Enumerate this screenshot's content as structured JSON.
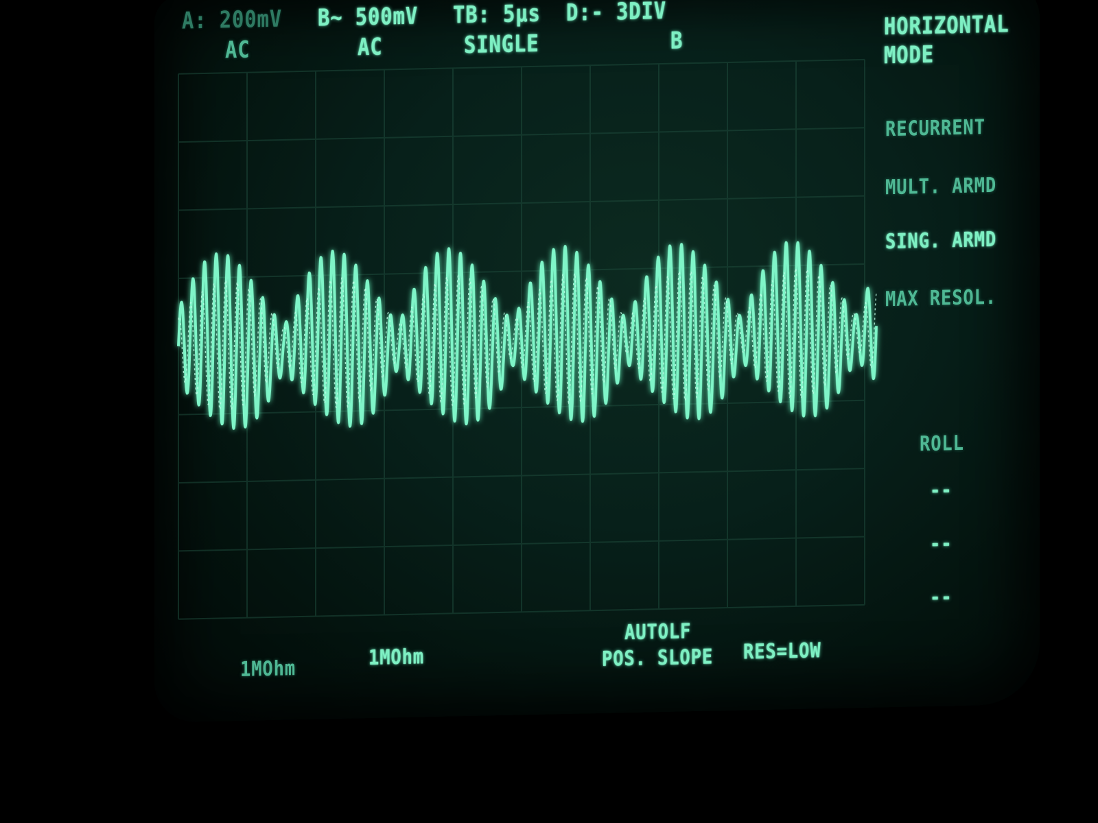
{
  "header": {
    "ch_a": "A: 200mV",
    "ch_b": "B~ 500mV",
    "timebase": "TB:   5μs",
    "delay": "D:-   3DIV",
    "ch_a_coupling": "AC",
    "ch_b_coupling": "AC",
    "trigger_mode": "SINGLE",
    "trigger_source": "B"
  },
  "softkeys": {
    "menu_title_1": "HORIZONTAL",
    "menu_title_2": "MODE",
    "recurrent": "RECURRENT",
    "mult_armd": "MULT. ARMD",
    "sing_armd": "SING. ARMD",
    "max_resol": "MAX RESOL.",
    "roll": "ROLL",
    "blank_1": "--",
    "blank_2": "--",
    "blank_3": "--"
  },
  "footer": {
    "ch_a_impedance": "1MOhm",
    "ch_b_impedance": "1MOhm",
    "trigger_coupling": "AUTOLF",
    "slope": "POS. SLOPE",
    "resolution": "RES=LOW"
  },
  "colors": {
    "phosphor": "#7ef0c3",
    "phosphor_dim": "#4fb894",
    "background": "#000000"
  }
}
